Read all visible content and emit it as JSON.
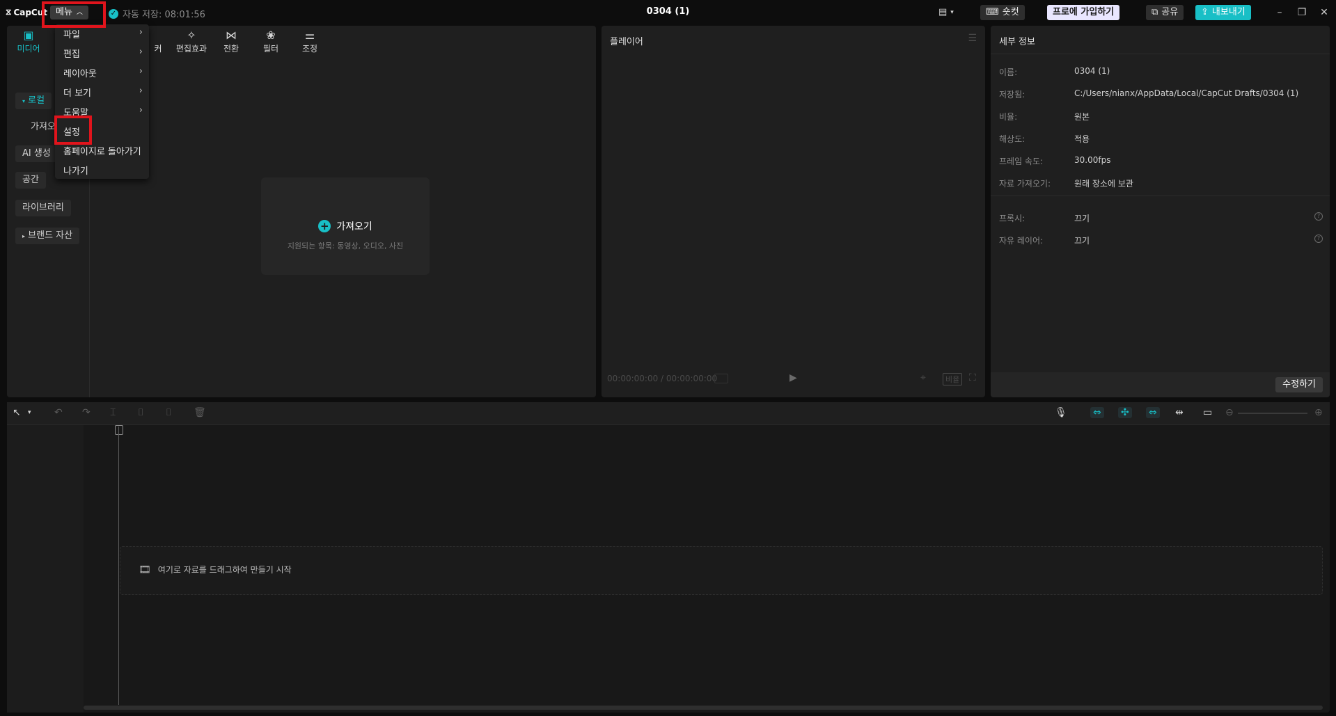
{
  "app": {
    "logo_text": "CapCut",
    "menu_label": "메뉴",
    "autosave_text": "자동 저장: 08:01:56",
    "project_title": "0304 (1)",
    "shortcut_label": "숏컷",
    "pro_label": "프로에 가입하기",
    "share_label": "공유",
    "export_label": "내보내기"
  },
  "menu": {
    "items": [
      {
        "label": "파일",
        "submenu": true
      },
      {
        "label": "편집",
        "submenu": true
      },
      {
        "label": "레이아웃",
        "submenu": true
      },
      {
        "label": "더 보기",
        "submenu": true
      },
      {
        "label": "도움말",
        "submenu": true
      },
      {
        "label": "설정",
        "submenu": false
      },
      {
        "label": "홈페이지로 돌아가기",
        "submenu": false
      },
      {
        "label": "나가기",
        "submenu": false
      }
    ]
  },
  "toolbar": {
    "tabs": [
      {
        "label": "미디어",
        "icon": "media-icon"
      },
      {
        "label": "커",
        "icon": "sticker-icon"
      },
      {
        "label": "편집효과",
        "icon": "effects-icon"
      },
      {
        "label": "전환",
        "icon": "transition-icon"
      },
      {
        "label": "필터",
        "icon": "filter-icon"
      },
      {
        "label": "조정",
        "icon": "adjust-icon"
      }
    ]
  },
  "media_sidebar": {
    "items": [
      "로컬",
      "가져오기",
      "AI 생성",
      "공간",
      "라이브러리",
      "브랜드 자산"
    ]
  },
  "import": {
    "label": "가져오기",
    "supported": "지원되는 항목: 동영상, 오디오, 사진"
  },
  "player": {
    "title": "플레이어",
    "timecode": "00:00:00:00 / 00:00:00:00",
    "ratio_label": "비율"
  },
  "details": {
    "title": "세부 정보",
    "rows": [
      {
        "label": "이름:",
        "value": "0304 (1)"
      },
      {
        "label": "저장됨:",
        "value": "C:/Users/nianx/AppData/Local/CapCut Drafts/0304 (1)"
      },
      {
        "label": "비율:",
        "value": "원본"
      },
      {
        "label": "해상도:",
        "value": "적용"
      },
      {
        "label": "프레임 속도:",
        "value": "30.00fps"
      },
      {
        "label": "자료 가져오기:",
        "value": "원래 장소에 보관"
      },
      {
        "label": "프록시:",
        "value": "끄기"
      },
      {
        "label": "자유 레이어:",
        "value": "끄기"
      }
    ],
    "edit_button": "수정하기"
  },
  "timeline": {
    "drop_text": "여기로 자료를 드래그하여 만들기 시작"
  },
  "colors": {
    "accent": "#18bfc6",
    "highlight": "#e0141c",
    "background": "#0d0d0d",
    "panel": "#1f1f1f"
  }
}
